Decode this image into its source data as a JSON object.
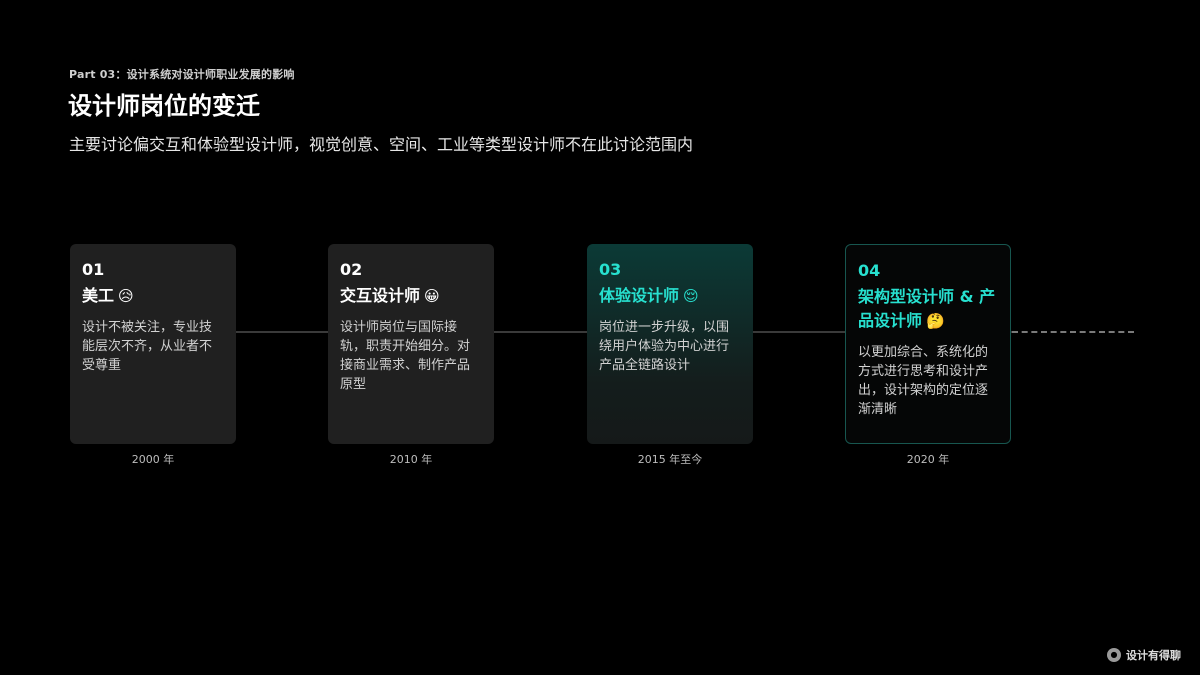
{
  "header": {
    "eyebrow": "Part 03：设计系统对设计师职业发展的影响",
    "title": "设计师岗位的变迁",
    "subtitle": "主要讨论偏交互和体验型设计师，视觉创意、空间、工业等类型设计师不在此讨论范围内"
  },
  "cards": [
    {
      "number": "01",
      "role": "美工",
      "emoji": "😥",
      "emoji_icon": "sad-face-icon",
      "description": "设计不被关注，专业技能层次不齐，从业者不受尊重",
      "year": "2000 年"
    },
    {
      "number": "02",
      "role": "交互设计师",
      "emoji": "😀",
      "emoji_icon": "grinning-face-icon",
      "description": "设计师岗位与国际接轨，职责开始细分。对接商业需求、制作产品原型",
      "year": "2010 年"
    },
    {
      "number": "03",
      "role": "体验设计师",
      "emoji": "😌",
      "emoji_icon": "relieved-face-icon",
      "description": "岗位进一步升级，以围绕用户体验为中心进行产品全链路设计",
      "year": "2015 年至今"
    },
    {
      "number": "04",
      "role": "架构型设计师 & 产品设计师",
      "emoji": "🤔",
      "emoji_icon": "thinking-face-icon",
      "description": "以更加综合、系统化的方式进行思考和设计产出，设计架构的定位逐渐清晰",
      "year": "2020 年"
    }
  ],
  "colors": {
    "background": "#000000",
    "accent": "#27e0cf",
    "card": "#202020"
  },
  "footer": {
    "brand": "设计有得聊",
    "brand_icon": "brand-logo-icon"
  }
}
